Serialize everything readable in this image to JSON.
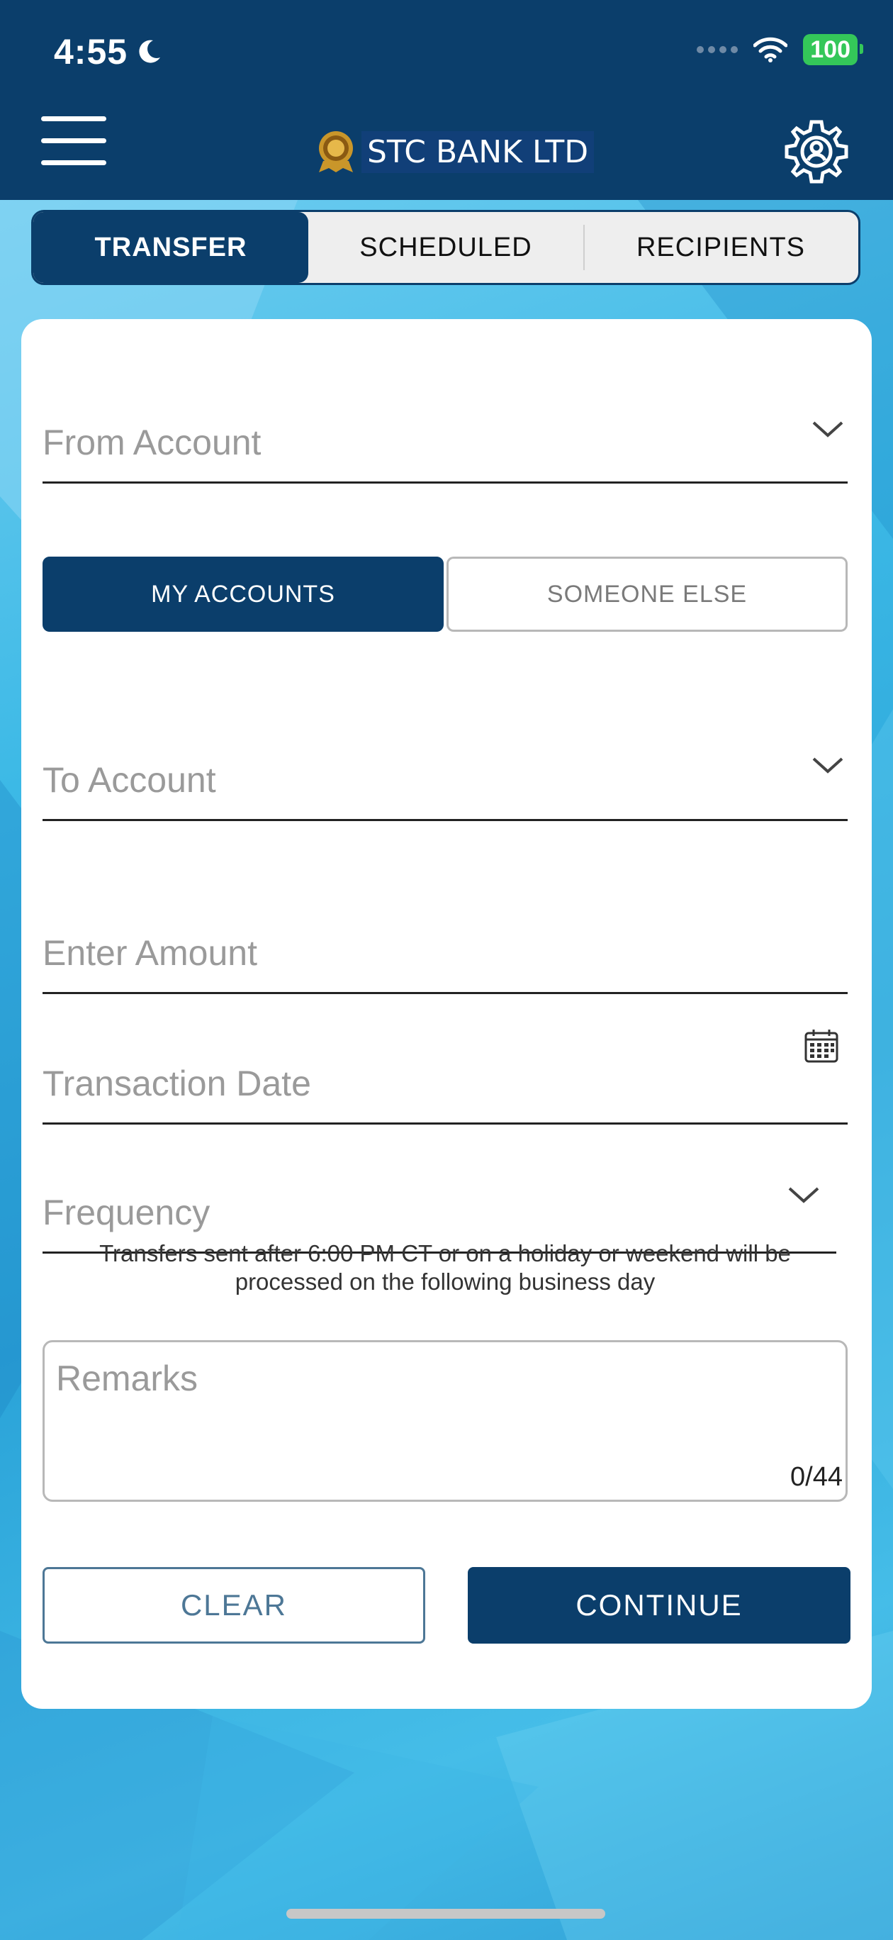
{
  "status_bar": {
    "time": "4:55",
    "battery": "100"
  },
  "header": {
    "bank_name": "STC BANK LTD"
  },
  "tabs": [
    {
      "label": "TRANSFER",
      "active": true
    },
    {
      "label": "SCHEDULED",
      "active": false
    },
    {
      "label": "RECIPIENTS",
      "active": false
    }
  ],
  "form": {
    "from_account_placeholder": "From Account",
    "recipient_type": {
      "options": [
        "MY ACCOUNTS",
        "SOMEONE ELSE"
      ],
      "selected": "MY ACCOUNTS"
    },
    "to_account_placeholder": "To Account",
    "amount_placeholder": "Enter Amount",
    "date_placeholder": "Transaction Date",
    "frequency_placeholder": "Frequency",
    "note": "Transfers sent after 6:00 PM CT or on a holiday or weekend will be processed on the following business day",
    "remarks_placeholder": "Remarks",
    "remarks_counter": "0/44",
    "clear_label": "CLEAR",
    "continue_label": "CONTINUE"
  },
  "colors": {
    "primary": "#0b3e6b",
    "background": "#3aaede",
    "battery": "#34c759"
  },
  "icons": [
    "menu-icon",
    "bank-logo-icon",
    "settings-gear-icon",
    "chevron-down-icon",
    "calendar-icon",
    "moon-icon",
    "wifi-icon"
  ]
}
